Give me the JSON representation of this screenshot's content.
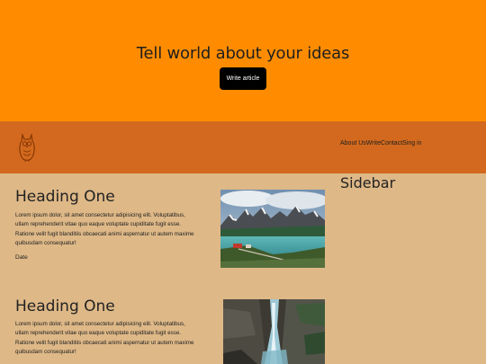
{
  "hero": {
    "title": "Tell world about your ideas",
    "button_label": "Write article"
  },
  "nav": {
    "logo_icon": "owl-logo-icon",
    "links": [
      "About Us",
      "Write",
      "Contact",
      "Sing in"
    ]
  },
  "posts": [
    {
      "heading": "Heading One",
      "body": "Lorem ipsum dolor, sit amet consectetur adipisicing elit. Voluptatibus, ullam reprehenderit vitae quo eaque voluptate cupiditate fugit esse. Ratione velit fugit blanditiis obcaecati animi aspernatur ut autem maxime quibusdam consequatur!",
      "date": "Date",
      "image": "mountain-lake-photo"
    },
    {
      "heading": "Heading One",
      "body": "Lorem ipsum dolor, sit amet consectetur adipisicing elit. Voluptatibus, ullam reprehenderit vitae quo eaque voluptate cupiditate fugit esse. Ratione velit fugit blanditiis obcaecati animi aspernatur ut autem maxime quibusdam consequatur!",
      "image": "canyon-waterfall-photo"
    }
  ],
  "sidebar": {
    "title": "Sidebar"
  },
  "colors": {
    "hero_bg": "#ff8c00",
    "nav_bg": "#d2691e",
    "content_bg": "#deb887",
    "button_bg": "#000000"
  }
}
